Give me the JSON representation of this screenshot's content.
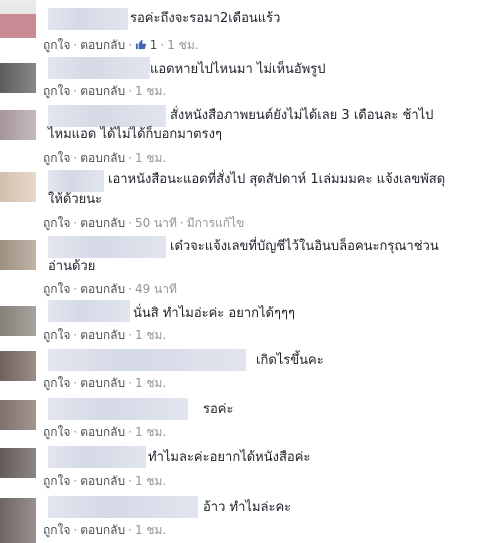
{
  "action_like": "ถูกใจ",
  "action_reply": "ตอบกลับ",
  "comments": [
    {
      "text": "รอค่ะถึงจะรอมา2เดือนแร้ว",
      "like_count": "1",
      "time": "1 ชม.",
      "avatar_color": "#c98c95"
    },
    {
      "text": "แอดหายไปไหนมา ไม่เห็นอัพรูป",
      "time": "1 ชม.",
      "avatar_color": "#6f6d6d"
    },
    {
      "text": "สั่งหนังสือภาพยนต์ยังไม่ได้เลย 3 เดือนละ ช้าไป",
      "text2": "ไหมแอด ได้ไม่ได้ก็บอกมาตรงๆ",
      "time": "1 ชม.",
      "avatar_color": "#b5a9ac"
    },
    {
      "text": "เอาหนังสือนะแอดที่สั่งไป สุดสัปดาห์ 1เล่มมมคะ แจ้งเลขพัสดุ",
      "text2": "ให้ด้วยนะ",
      "time": "50 นาที",
      "edited": "มีการแก้ไข",
      "avatar_color": "#d9c7b4"
    },
    {
      "text": "เด๋วจะแจ้งเลขที่บัญชีไว้ในอินบล็อคนะกรุณาช่วน",
      "text2": "อ่านด้วย",
      "time": "49 นาที",
      "avatar_color": "#a89a8d"
    },
    {
      "text": "นั่นสิ ทำไมอ่ะค่ะ อยากได้ๆๆๆ",
      "time": "1 ชม.",
      "avatar_color": "#8e8a86"
    },
    {
      "text": "เกิดไรขึ้นคะ",
      "time": "1 ชม.",
      "avatar_color": "#7b6e6a"
    },
    {
      "text": "รอค่ะ",
      "time": "1 ชม.",
      "avatar_color": "#8a7c78"
    },
    {
      "text": "ทำไมละค่ะอยากได้หนังสือค่ะ",
      "time": "1 ชม.",
      "avatar_color": "#6d6663"
    },
    {
      "text": "อ้าว ทำไมล่ะคะ",
      "time": "1 ชม.",
      "avatar_color": "#7a726f"
    }
  ]
}
